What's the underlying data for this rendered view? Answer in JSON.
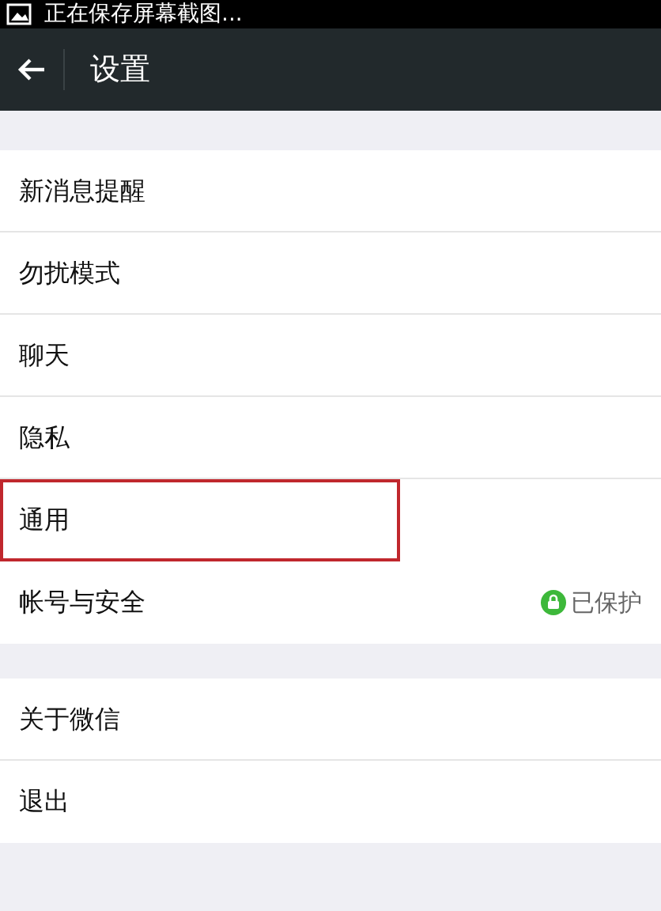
{
  "status_bar": {
    "notification": "正在保存屏幕截图..."
  },
  "header": {
    "title": "设置"
  },
  "groups": [
    {
      "items": [
        {
          "label": "新消息提醒",
          "highlighted": false
        },
        {
          "label": "勿扰模式",
          "highlighted": false
        },
        {
          "label": "聊天",
          "highlighted": false
        },
        {
          "label": "隐私",
          "highlighted": false
        },
        {
          "label": "通用",
          "highlighted": true
        },
        {
          "label": "帐号与安全",
          "highlighted": false,
          "status": "已保护"
        }
      ]
    },
    {
      "items": [
        {
          "label": "关于微信",
          "highlighted": false
        },
        {
          "label": "退出",
          "highlighted": false
        }
      ]
    }
  ]
}
